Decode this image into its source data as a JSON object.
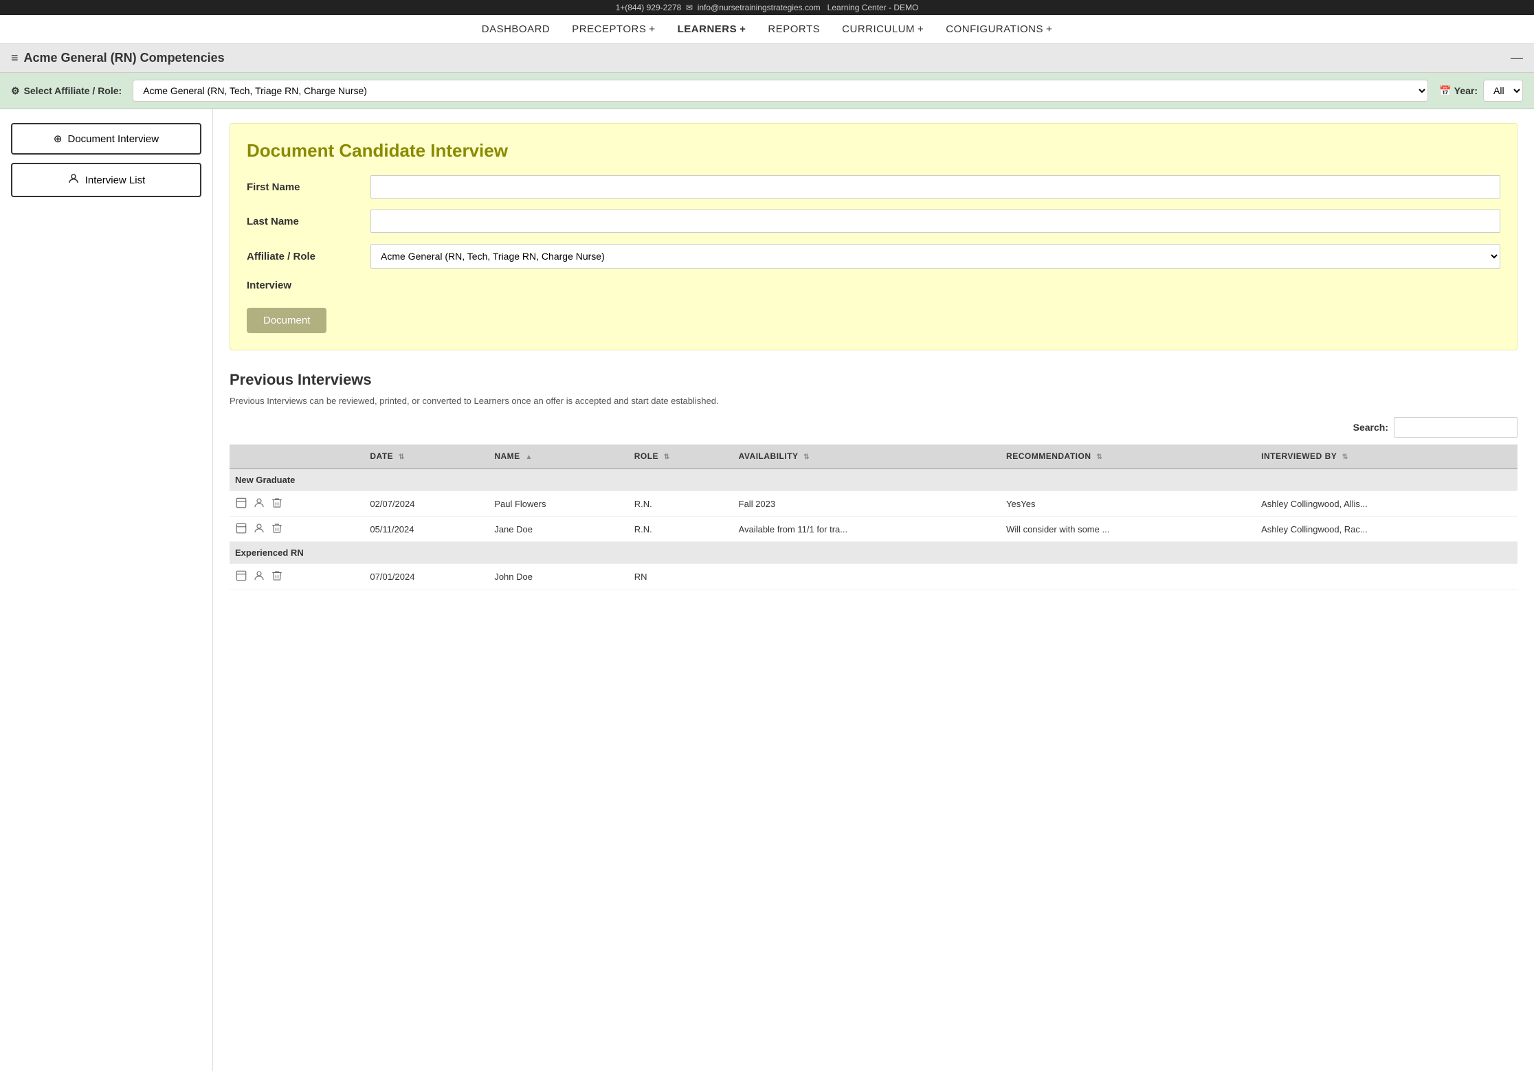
{
  "topBar": {
    "phone": "1+(844) 929-2278",
    "email": "info@nursetrainingstrategies.com",
    "learningCenter": "Learning Center - DEMO"
  },
  "nav": {
    "items": [
      {
        "id": "dashboard",
        "label": "DASHBOARD",
        "hasPlus": false
      },
      {
        "id": "preceptors",
        "label": "PRECEPTORS",
        "hasPlus": true
      },
      {
        "id": "learners",
        "label": "LEARNERS",
        "hasPlus": true,
        "active": true
      },
      {
        "id": "reports",
        "label": "REPORTS",
        "hasPlus": false
      },
      {
        "id": "curriculum",
        "label": "CURRICULUM",
        "hasPlus": true
      },
      {
        "id": "configurations",
        "label": "CONFIGURATIONS",
        "hasPlus": true
      }
    ]
  },
  "pageHeader": {
    "menuIcon": "≡",
    "title": "Acme General (RN) Competencies",
    "closeIcon": "—"
  },
  "affiliateBar": {
    "label": "Select Affiliate / Role:",
    "affiliateIcon": "⚙",
    "affiliateValue": "Acme General (RN, Tech, Triage RN, Charge Nurse)",
    "yearLabel": "Year:",
    "yearIcon": "📅",
    "yearValue": "All"
  },
  "sidebar": {
    "buttons": [
      {
        "id": "document-interview",
        "icon": "⊕",
        "label": "Document Interview"
      },
      {
        "id": "interview-list",
        "icon": "👤",
        "label": "Interview List"
      }
    ]
  },
  "form": {
    "title": "Document Candidate Interview",
    "fields": [
      {
        "id": "first-name",
        "label": "First Name",
        "type": "text",
        "value": ""
      },
      {
        "id": "last-name",
        "label": "Last Name",
        "type": "text",
        "value": ""
      },
      {
        "id": "affiliate-role",
        "label": "Affiliate / Role",
        "type": "select",
        "value": "Acme General (RN, Tech, Triage RN, Charge Nurse)"
      }
    ],
    "interviewLabel": "Interview",
    "documentButton": "Document"
  },
  "previousInterviews": {
    "title": "Previous Interviews",
    "description": "Previous Interviews can be reviewed, printed, or converted to Learners once an offer is accepted and start date established.",
    "searchLabel": "Search:",
    "searchPlaceholder": "",
    "tableHeaders": [
      {
        "id": "date",
        "label": "DATE",
        "sortable": true
      },
      {
        "id": "name",
        "label": "NAME",
        "sortable": true,
        "sortDirection": "asc"
      },
      {
        "id": "role",
        "label": "ROLE",
        "sortable": true
      },
      {
        "id": "availability",
        "label": "AVAILABILITY",
        "sortable": true
      },
      {
        "id": "recommendation",
        "label": "RECOMMENDATION",
        "sortable": true
      },
      {
        "id": "interviewed-by",
        "label": "INTERVIEWED BY",
        "sortable": true
      }
    ],
    "groups": [
      {
        "groupName": "New Graduate",
        "rows": [
          {
            "date": "02/07/2024",
            "name": "Paul Flowers",
            "role": "R.N.",
            "availability": "Fall 2023",
            "recommendation": "YesYes",
            "interviewedBy": "Ashley Collingwood, Allis..."
          },
          {
            "date": "05/11/2024",
            "name": "Jane Doe",
            "role": "R.N.",
            "availability": "Available from 11/1 for tra...",
            "recommendation": "Will consider with some ...",
            "interviewedBy": "Ashley Collingwood, Rac..."
          }
        ]
      },
      {
        "groupName": "Experienced RN",
        "rows": [
          {
            "date": "07/01/2024",
            "name": "John Doe",
            "role": "RN",
            "availability": "",
            "recommendation": "",
            "interviewedBy": ""
          }
        ]
      }
    ]
  }
}
